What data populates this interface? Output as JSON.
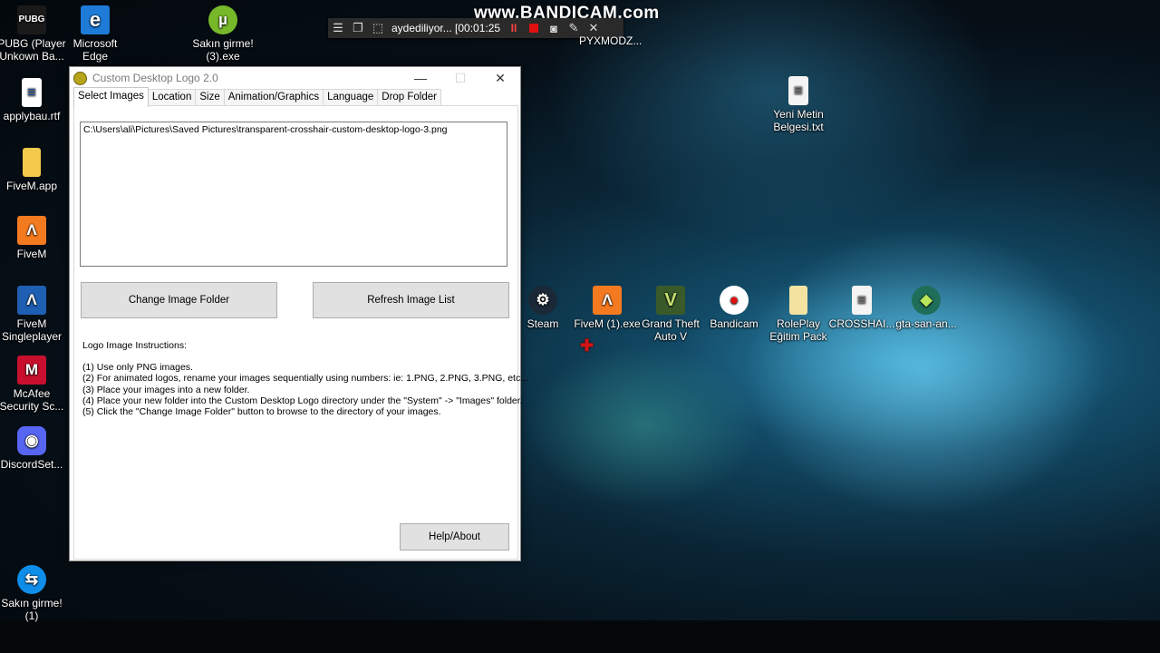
{
  "watermark": "www.BANDICAM.com",
  "recorder": {
    "status_text": "aydediliyor... [00:01:25",
    "pause_glyph": "II"
  },
  "overlay_text": "PYXMODZ...",
  "desktop_icons_left": [
    {
      "label": "PUBG (Player\nUnkown Ba...",
      "icon": "pubg-icon",
      "glyph": "PUBG"
    },
    {
      "label": "applybau.rtf",
      "icon": "document-icon",
      "glyph": "≡"
    },
    {
      "label": "FiveM.app",
      "icon": "folder-icon",
      "glyph": ""
    },
    {
      "label": "FiveM",
      "icon": "fivem-icon",
      "glyph": "Λ"
    },
    {
      "label": "FiveM\nSingleplayer",
      "icon": "fivem-singleplayer-icon",
      "glyph": "Λ"
    },
    {
      "label": "McAfee\nSecurity Sc...",
      "icon": "mcafee-icon",
      "glyph": "M"
    },
    {
      "label": "DiscordSet...",
      "icon": "discord-icon",
      "glyph": "◉"
    },
    {
      "label": "Sakın girme!\n(1)",
      "icon": "teamviewer-icon",
      "glyph": "⇆"
    }
  ],
  "desktop_icons_top": [
    {
      "label": "Microsoft\nEdge",
      "icon": "edge-icon",
      "glyph": "e"
    },
    {
      "label": "Sakın girme!\n(3).exe",
      "icon": "utorrent-icon",
      "glyph": "µ"
    }
  ],
  "desktop_icons_right": [
    {
      "label": "Yeni Metin\nBelgesi.txt",
      "icon": "text-file-icon",
      "glyph": "≡"
    },
    {
      "label": "Steam",
      "icon": "steam-icon",
      "glyph": "⚙"
    },
    {
      "label": "FiveM (1).exe",
      "icon": "fivem-exe-icon",
      "glyph": "Λ"
    },
    {
      "label": "Grand Theft\nAuto V",
      "icon": "gta-v-icon",
      "glyph": "V"
    },
    {
      "label": "Bandicam",
      "icon": "bandicam-icon",
      "glyph": "●"
    },
    {
      "label": "RolePlay\nEğitim Pack",
      "icon": "folder-icon",
      "glyph": ""
    },
    {
      "label": "CROSSHAI...",
      "icon": "document-icon",
      "glyph": "≡"
    },
    {
      "label": "gta-san-an...",
      "icon": "gta-sa-icon",
      "glyph": "◆"
    }
  ],
  "window": {
    "title": "Custom Desktop Logo 2.0",
    "tabs": [
      "Select Images",
      "Location",
      "Size",
      "Animation/Graphics",
      "Language",
      "Drop Folder"
    ],
    "active_tab": "Select Images",
    "image_path": "C:\\Users\\ali\\Pictures\\Saved Pictures\\transparent-crosshair-custom-desktop-logo-3.png",
    "change_folder_label": "Change Image Folder",
    "refresh_label": "Refresh Image List",
    "help_label": "Help/About",
    "instructions_title": "Logo Image Instructions:",
    "instructions": [
      "(1) Use only PNG images.",
      "(2) For animated logos, rename your images sequentially using numbers: ie: 1.PNG, 2.PNG, 3.PNG, etc...",
      "(3) Place your images into a new folder.",
      "(4) Place your new folder into the Custom Desktop Logo directory under the \"System\" -> \"Images\" folder.",
      "(5) Click the \"Change Image Folder\" button to browse to the directory of your images."
    ]
  },
  "colors": {
    "fivem_orange": "#f47a20",
    "mcafee_red": "#c8102e",
    "discord_blue": "#5865f2",
    "folder_yellow": "#f3c94c",
    "record_red": "#e01010"
  }
}
